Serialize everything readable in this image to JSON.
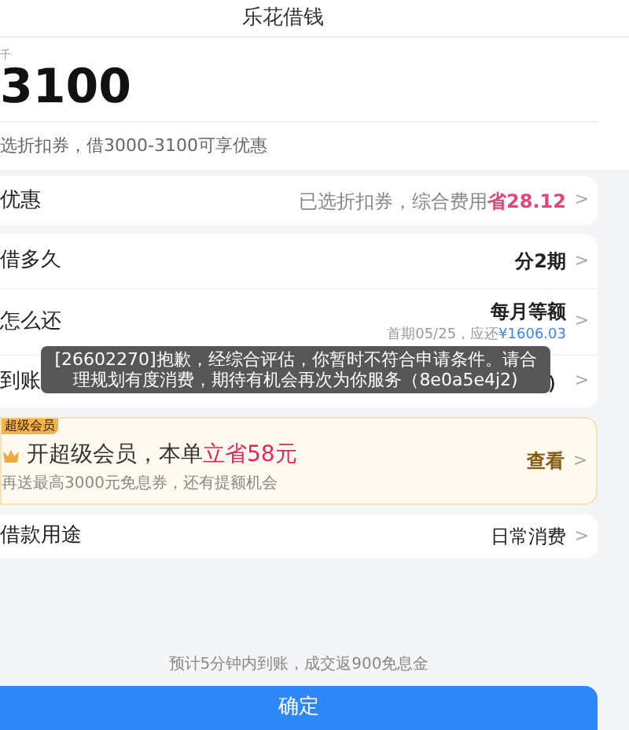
{
  "header": {
    "title": "乐花借钱"
  },
  "amount": {
    "label": "千",
    "value": "3100",
    "hint": "选折扣券，借3000-3100可享优惠"
  },
  "discount_row": {
    "label": "优惠",
    "value": "已选折扣券，综合费用",
    "highlight": "省28.12",
    "chevron": ">"
  },
  "loan_rows": [
    {
      "kind": "plain",
      "label": "借多久",
      "value": "分2期",
      "chevron": ">"
    },
    {
      "kind": "detail",
      "label": "怎么还",
      "value": "每月等额",
      "sub": "首期05/25，应还",
      "sub_amount": "¥1606.03",
      "chevron": ">"
    },
    {
      "kind": "plain",
      "label": "到账",
      "value": "）",
      "chevron": ">"
    }
  ],
  "toast": {
    "text": "[26602270]抱歉，经综合评估，你暂时不符合申请条件。请合理规划有度消费，期待有机会再次为你服务（8e0a5e4j2)"
  },
  "membership": {
    "badge": "超级会员",
    "title": "开超级会员，本单",
    "highlight": "立省58元",
    "subtitle": "再送最高3000元免息券，还有提额机会",
    "action": "查看",
    "chevron": ">"
  },
  "purpose_row": {
    "label": "借款用途",
    "value": "日常消费",
    "chevron": ">"
  },
  "footer": {
    "note": "预计5分钟内到账，成交返900免息金",
    "confirm": "确定"
  }
}
